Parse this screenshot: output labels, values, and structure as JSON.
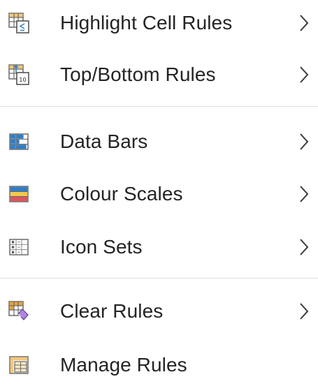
{
  "menu": {
    "items": [
      {
        "label": "Highlight Cell Rules",
        "icon": "highlight-cell-rules-icon",
        "has_submenu": true
      },
      {
        "label": "Top/Bottom Rules",
        "icon": "top-bottom-rules-icon",
        "has_submenu": true
      },
      {
        "label": "Data Bars",
        "icon": "data-bars-icon",
        "has_submenu": true
      },
      {
        "label": "Colour Scales",
        "icon": "colour-scales-icon",
        "has_submenu": true
      },
      {
        "label": "Icon Sets",
        "icon": "icon-sets-icon",
        "has_submenu": true
      },
      {
        "label": "Clear Rules",
        "icon": "clear-rules-icon",
        "has_submenu": true
      },
      {
        "label": "Manage Rules",
        "icon": "manage-rules-icon",
        "has_submenu": false
      }
    ],
    "top_bottom_icon_number": "10",
    "colors": {
      "text": "#242424",
      "divider": "#e1e1e1",
      "icon_accent_blue": "#2f7ec9",
      "icon_orange": "#e8a33c",
      "icon_red": "#e0535b",
      "icon_yellow": "#f2c94c",
      "icon_purple": "#b384e0"
    }
  }
}
